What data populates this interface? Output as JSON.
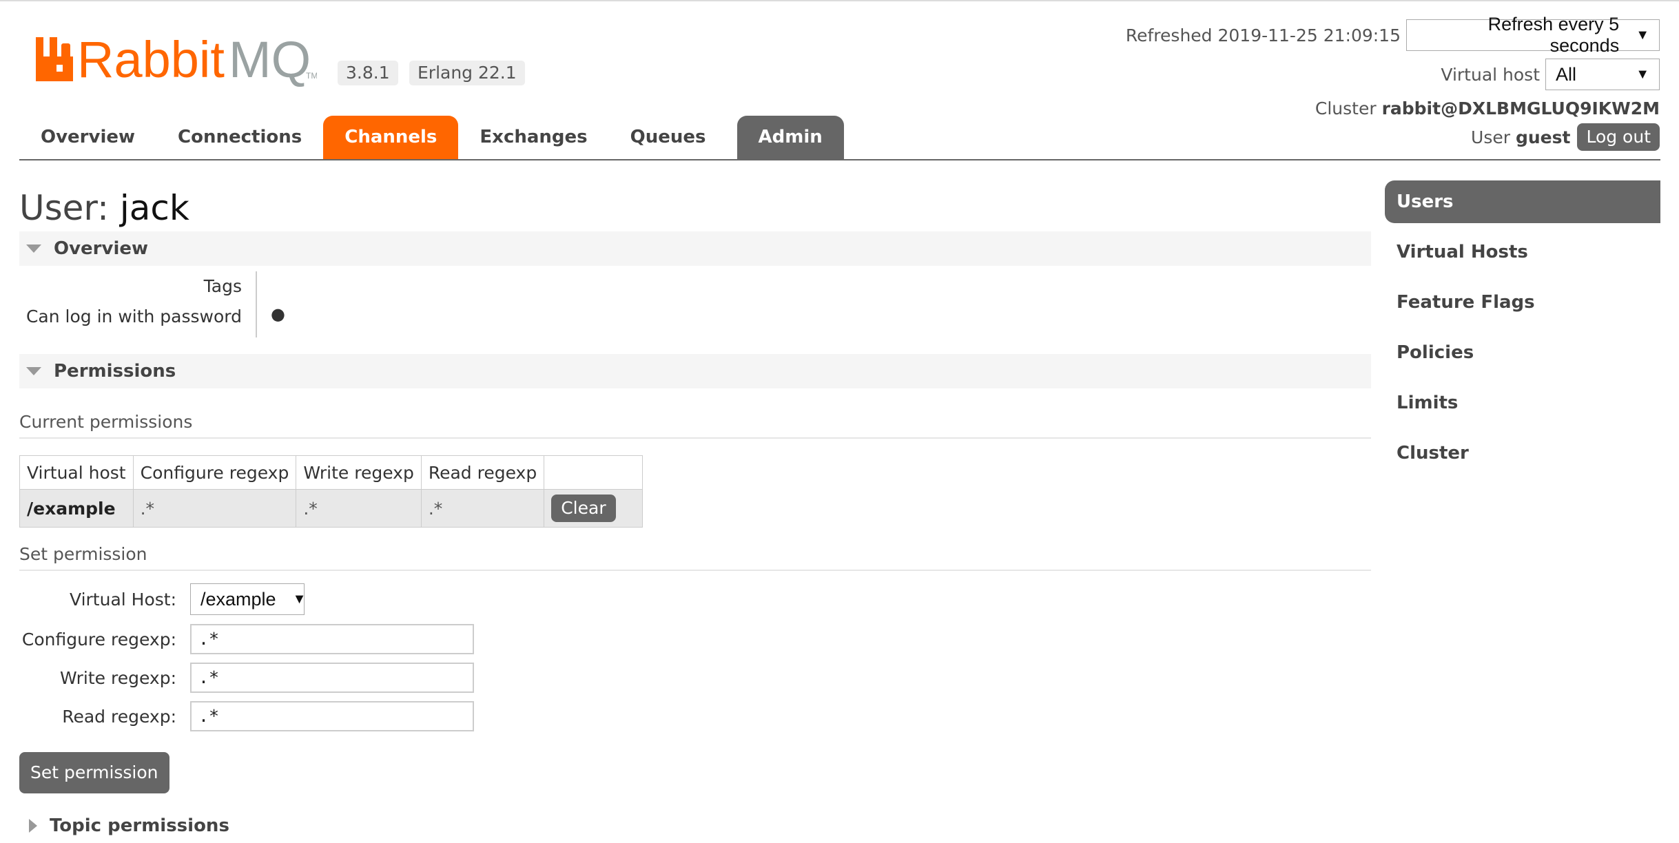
{
  "app": {
    "logo_text": "RabbitMQ",
    "version": "3.8.1",
    "erlang": "Erlang 22.1"
  },
  "header": {
    "refreshed_label": "Refreshed 2019-11-25 21:09:15",
    "refresh_select": "Refresh every 5 seconds",
    "vhost_label": "Virtual host",
    "vhost_select": "All",
    "cluster_label": "Cluster",
    "cluster_name": "rabbit@DXLBMGLUQ9IKW2M",
    "user_label": "User",
    "user_name": "guest",
    "logout": "Log out"
  },
  "tabs": [
    {
      "label": "Overview"
    },
    {
      "label": "Connections"
    },
    {
      "label": "Channels",
      "active": true
    },
    {
      "label": "Exchanges"
    },
    {
      "label": "Queues"
    },
    {
      "label": "Admin"
    }
  ],
  "page": {
    "title_prefix": "User:",
    "title_name": "jack"
  },
  "overview": {
    "heading": "Overview",
    "tags_label": "Tags",
    "login_label": "Can log in with password",
    "login_value": "●"
  },
  "permissions": {
    "heading": "Permissions",
    "current_heading": "Current permissions",
    "columns": [
      "Virtual host",
      "Configure regexp",
      "Write regexp",
      "Read regexp",
      ""
    ],
    "rows": [
      {
        "vhost": "/example",
        "configure": ".*",
        "write": ".*",
        "read": ".*",
        "action": "Clear"
      }
    ],
    "set_heading": "Set permission",
    "form": {
      "vhost_label": "Virtual Host:",
      "vhost_value": "/example",
      "configure_label": "Configure regexp:",
      "configure_value": ".*",
      "write_label": "Write regexp:",
      "write_value": ".*",
      "read_label": "Read regexp:",
      "read_value": ".*",
      "submit": "Set permission"
    }
  },
  "topic_permissions": {
    "heading": "Topic permissions"
  },
  "sidebar": {
    "items": [
      {
        "label": "Users",
        "active": true
      },
      {
        "label": "Virtual Hosts"
      },
      {
        "label": "Feature Flags"
      },
      {
        "label": "Policies"
      },
      {
        "label": "Limits"
      },
      {
        "label": "Cluster"
      }
    ]
  },
  "colors": {
    "brand_orange": "#ff6600",
    "tab_gray": "#666666"
  }
}
